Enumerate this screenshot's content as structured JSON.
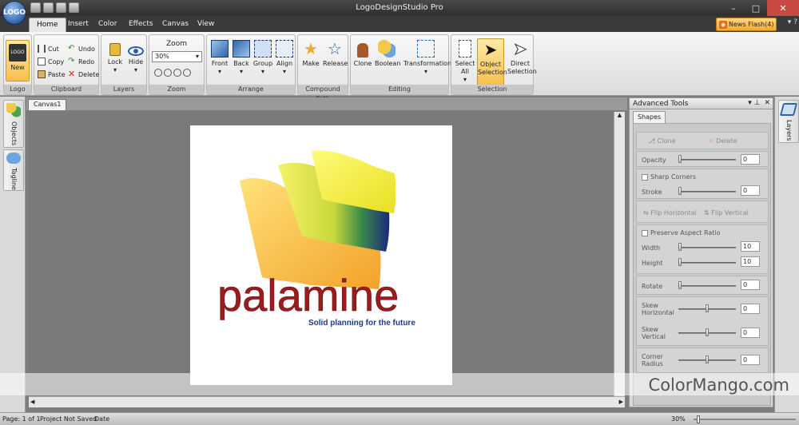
{
  "app": {
    "title": "LogoDesignStudio Pro",
    "orb_label": "LOGO"
  },
  "window_controls": {
    "minimize": "–",
    "maximize": "□",
    "close": "✕"
  },
  "tabs": [
    {
      "label": "Home",
      "active": true
    },
    {
      "label": "Insert"
    },
    {
      "label": "Color"
    },
    {
      "label": "Effects"
    },
    {
      "label": "Canvas"
    },
    {
      "label": "View"
    }
  ],
  "news_flash": "News Flash(4)",
  "help": {
    "dropdown": "▾",
    "question": "?"
  },
  "ribbon": {
    "logo": {
      "new_label": "New",
      "group": "Logo",
      "new_icon_text": "LOGO"
    },
    "clipboard": {
      "cut": "Cut",
      "copy": "Copy",
      "paste": "Paste",
      "undo": "Undo",
      "redo": "Redo",
      "delete": "Delete",
      "group": "Clipboard"
    },
    "layers": {
      "lock": "Lock",
      "hide": "Hide",
      "group": "Layers"
    },
    "zoom": {
      "title": "Zoom",
      "value": "30%",
      "group": "Zoom"
    },
    "arrange": {
      "front": "Front",
      "back": "Back",
      "group_btn": "Group",
      "align": "Align",
      "group": "Arrange"
    },
    "compound": {
      "make": "Make",
      "release": "Release",
      "group": "Compound Path"
    },
    "editing": {
      "clone": "Clone",
      "boolean": "Boolean",
      "transformation": "Transformation",
      "group": "Editing"
    },
    "selection": {
      "select_all": "Select All",
      "object": "Object Selection",
      "direct": "Direct Selection",
      "group": "Selection"
    }
  },
  "left_tabs": [
    "Objects",
    "Tagline"
  ],
  "doc_tab": "Canvas1",
  "logo": {
    "brand": "palamine",
    "tagline": "Solid planning for the future"
  },
  "panel": {
    "title": "Advanced Tools",
    "pin": "▾ ⊥",
    "close": "✕",
    "tab": "Shapes",
    "clone": "Clone",
    "delete": "Delete",
    "opacity": {
      "label": "Opacity",
      "value": "0"
    },
    "sharp_corners": "Sharp Corners",
    "stroke": {
      "label": "Stroke",
      "value": "0"
    },
    "flip_h": "Flip Horizontal",
    "flip_v": "Flip Vertical",
    "preserve": "Preserve Aspect Ratio",
    "width": {
      "label": "Width",
      "value": "10"
    },
    "height": {
      "label": "Height",
      "value": "10"
    },
    "rotate": {
      "label": "Rotate",
      "value": "0"
    },
    "skew_h": {
      "label": "Skew Horizontal",
      "value": "0"
    },
    "skew_v": {
      "label": "Skew Vertical",
      "value": "0"
    },
    "corner": {
      "label": "Corner Radius",
      "value": "0"
    }
  },
  "right_tab": "Layers",
  "status": {
    "page": "Page: 1 of 1",
    "saved": "Project Not Saved",
    "date": "Date",
    "zoom": "30%"
  },
  "watermark": "ColorMango.com",
  "colors": {
    "brand_red": "#9b1b1e",
    "tagline_blue": "#1f3a8a",
    "accent_orange": "#f2a82d"
  }
}
